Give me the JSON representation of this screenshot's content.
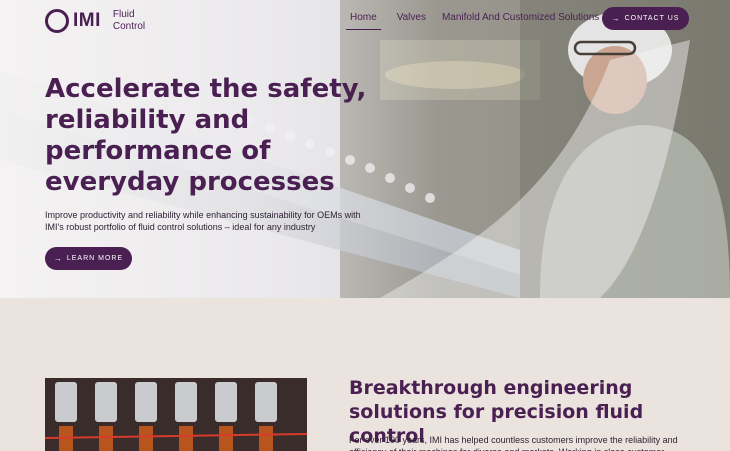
{
  "brand": {
    "logo_text": "IMI",
    "sub_line1": "Fluid",
    "sub_line2": "Control",
    "color": "#4a1f52"
  },
  "nav": {
    "items": [
      {
        "label": "Home"
      },
      {
        "label": "Valves"
      },
      {
        "label": "Manifold And Customized Solutions"
      }
    ],
    "cta_label": "CONTACT US"
  },
  "hero": {
    "title": "Accelerate the safety, reliability and performance of everyday processes",
    "body": "Improve productivity and reliability while enhancing sustainability for OEMs with IMI's robust portfolio of fluid control solutions – ideal for any industry",
    "button_label": "LEARN MORE"
  },
  "section": {
    "title": "Breakthrough engineering solutions for precision fluid control",
    "body": "For over 100 years, IMI has helped countless customers improve the reliability and efficiency of their machines for diverse end markets. Working in close customer"
  },
  "icons": {
    "arrow": "arrow-right-icon",
    "logo": "imi-ring-logo"
  }
}
